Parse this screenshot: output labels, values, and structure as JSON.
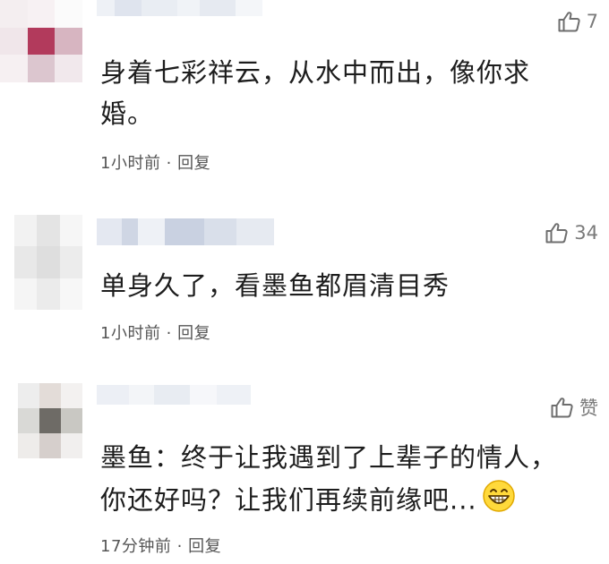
{
  "comments": [
    {
      "likes": "7",
      "text_lines": [
        "身着七彩祥云，从水中而出，像你求",
        "婚。"
      ],
      "time": "1小时前",
      "reply": "回复"
    },
    {
      "likes": "34",
      "text_lines": [
        "单身久了，看墨鱼都眉清目秀"
      ],
      "time": "1小时前",
      "reply": "回复"
    },
    {
      "likes": "赞",
      "text_lines": [
        "墨鱼：终于让我遇到了上辈子的情人，",
        "你还好吗？让我们再续前缘吧..."
      ],
      "time": "17分钟前",
      "reply": "回复"
    }
  ],
  "separator": " · ",
  "icons": {
    "like": "thumbs-up-icon",
    "emoji": "grinning-face-icon"
  },
  "colors": {
    "text": "#1d1d1d",
    "meta": "#555555",
    "like": "#7a7a7a"
  }
}
